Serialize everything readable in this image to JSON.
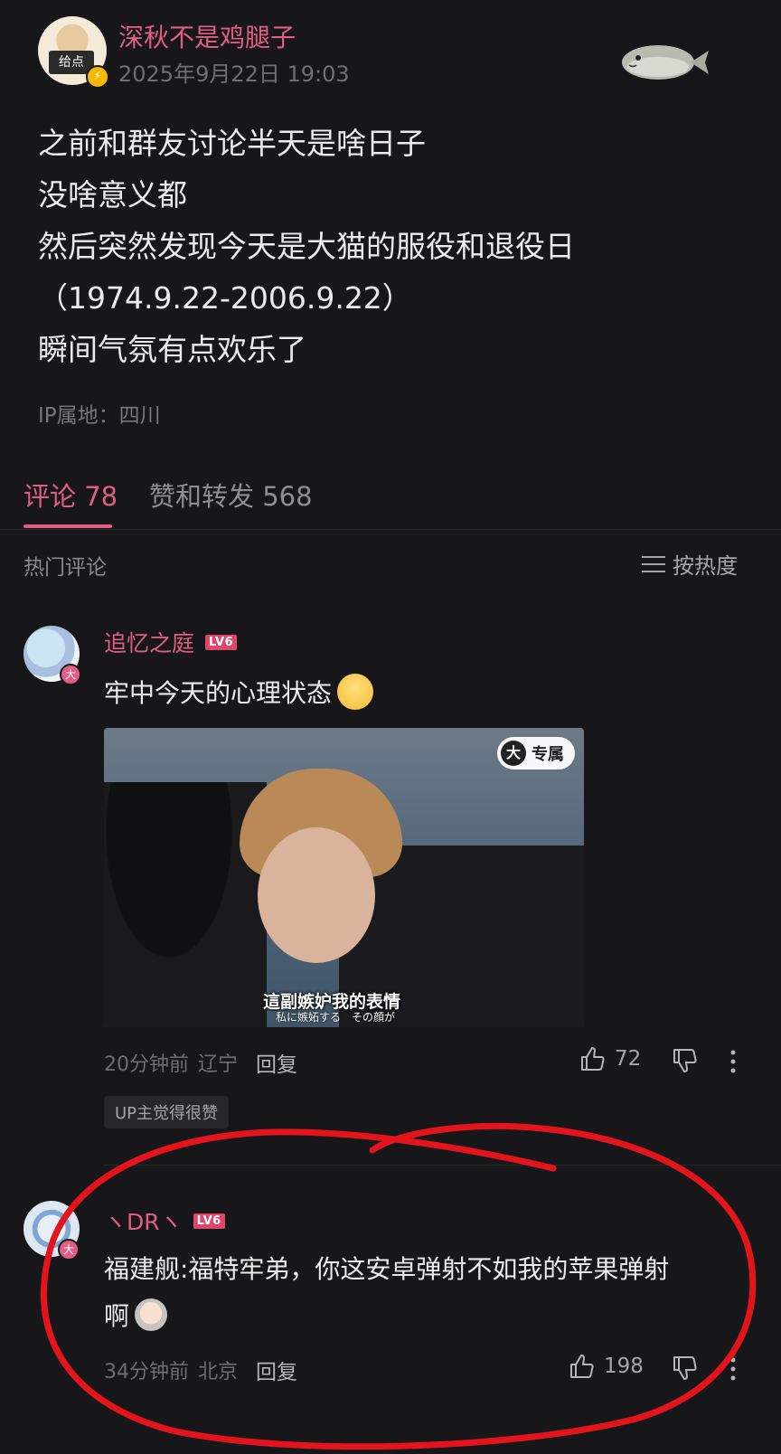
{
  "post": {
    "author": "深秋不是鸡腿子",
    "time": "2025年9月22日 19:03",
    "avatar_sign": "给点",
    "lines": [
      "之前和群友讨论半天是啥日子",
      "没啥意义都",
      "然后突然发现今天是大猫的服役和退役日",
      "（1974.9.22-2006.9.22）",
      "瞬间气氛有点欢乐了"
    ],
    "ip": "IP属地：四川"
  },
  "tabs": {
    "comments": "评论 78",
    "likes": "赞和转发 568"
  },
  "section": {
    "hot": "热门评论",
    "sort": "按热度"
  },
  "comments": [
    {
      "user": "追忆之庭",
      "level": "LV6",
      "badge": "大",
      "text": "牢中今天的心理状态",
      "video": {
        "exclusive": "专属",
        "exclusive_icon": "大",
        "subtitle": "這副嫉妒我的表情",
        "subtitle_sub": "私に嫉妬する　その顔が"
      },
      "time": "20分钟前",
      "location": "辽宁",
      "reply": "回复",
      "likes": "72",
      "up_tag": "UP主觉得很赞"
    },
    {
      "user": "ヽDRヽ",
      "level": "LV6",
      "badge": "大",
      "text_line1": "福建舰:福特牢弟，你这安卓弹射不如我的苹果弹射",
      "text_line2": "啊",
      "time": "34分钟前",
      "location": "北京",
      "reply": "回复",
      "likes": "198"
    }
  ],
  "colors": {
    "background": "#17171a",
    "accent_pink": "#e05d84",
    "annotation_red": "#e3141b"
  }
}
